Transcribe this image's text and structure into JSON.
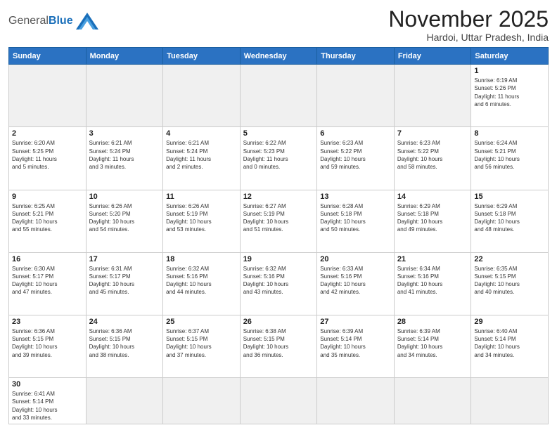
{
  "logo": {
    "text_general": "General",
    "text_blue": "Blue"
  },
  "title": "November 2025",
  "subtitle": "Hardoi, Uttar Pradesh, India",
  "weekdays": [
    "Sunday",
    "Monday",
    "Tuesday",
    "Wednesday",
    "Thursday",
    "Friday",
    "Saturday"
  ],
  "weeks": [
    [
      {
        "day": "",
        "info": ""
      },
      {
        "day": "",
        "info": ""
      },
      {
        "day": "",
        "info": ""
      },
      {
        "day": "",
        "info": ""
      },
      {
        "day": "",
        "info": ""
      },
      {
        "day": "",
        "info": ""
      },
      {
        "day": "1",
        "info": "Sunrise: 6:19 AM\nSunset: 5:26 PM\nDaylight: 11 hours\nand 6 minutes."
      }
    ],
    [
      {
        "day": "2",
        "info": "Sunrise: 6:20 AM\nSunset: 5:25 PM\nDaylight: 11 hours\nand 5 minutes."
      },
      {
        "day": "3",
        "info": "Sunrise: 6:21 AM\nSunset: 5:24 PM\nDaylight: 11 hours\nand 3 minutes."
      },
      {
        "day": "4",
        "info": "Sunrise: 6:21 AM\nSunset: 5:24 PM\nDaylight: 11 hours\nand 2 minutes."
      },
      {
        "day": "5",
        "info": "Sunrise: 6:22 AM\nSunset: 5:23 PM\nDaylight: 11 hours\nand 0 minutes."
      },
      {
        "day": "6",
        "info": "Sunrise: 6:23 AM\nSunset: 5:22 PM\nDaylight: 10 hours\nand 59 minutes."
      },
      {
        "day": "7",
        "info": "Sunrise: 6:23 AM\nSunset: 5:22 PM\nDaylight: 10 hours\nand 58 minutes."
      },
      {
        "day": "8",
        "info": "Sunrise: 6:24 AM\nSunset: 5:21 PM\nDaylight: 10 hours\nand 56 minutes."
      }
    ],
    [
      {
        "day": "9",
        "info": "Sunrise: 6:25 AM\nSunset: 5:21 PM\nDaylight: 10 hours\nand 55 minutes."
      },
      {
        "day": "10",
        "info": "Sunrise: 6:26 AM\nSunset: 5:20 PM\nDaylight: 10 hours\nand 54 minutes."
      },
      {
        "day": "11",
        "info": "Sunrise: 6:26 AM\nSunset: 5:19 PM\nDaylight: 10 hours\nand 53 minutes."
      },
      {
        "day": "12",
        "info": "Sunrise: 6:27 AM\nSunset: 5:19 PM\nDaylight: 10 hours\nand 51 minutes."
      },
      {
        "day": "13",
        "info": "Sunrise: 6:28 AM\nSunset: 5:18 PM\nDaylight: 10 hours\nand 50 minutes."
      },
      {
        "day": "14",
        "info": "Sunrise: 6:29 AM\nSunset: 5:18 PM\nDaylight: 10 hours\nand 49 minutes."
      },
      {
        "day": "15",
        "info": "Sunrise: 6:29 AM\nSunset: 5:18 PM\nDaylight: 10 hours\nand 48 minutes."
      }
    ],
    [
      {
        "day": "16",
        "info": "Sunrise: 6:30 AM\nSunset: 5:17 PM\nDaylight: 10 hours\nand 47 minutes."
      },
      {
        "day": "17",
        "info": "Sunrise: 6:31 AM\nSunset: 5:17 PM\nDaylight: 10 hours\nand 45 minutes."
      },
      {
        "day": "18",
        "info": "Sunrise: 6:32 AM\nSunset: 5:16 PM\nDaylight: 10 hours\nand 44 minutes."
      },
      {
        "day": "19",
        "info": "Sunrise: 6:32 AM\nSunset: 5:16 PM\nDaylight: 10 hours\nand 43 minutes."
      },
      {
        "day": "20",
        "info": "Sunrise: 6:33 AM\nSunset: 5:16 PM\nDaylight: 10 hours\nand 42 minutes."
      },
      {
        "day": "21",
        "info": "Sunrise: 6:34 AM\nSunset: 5:16 PM\nDaylight: 10 hours\nand 41 minutes."
      },
      {
        "day": "22",
        "info": "Sunrise: 6:35 AM\nSunset: 5:15 PM\nDaylight: 10 hours\nand 40 minutes."
      }
    ],
    [
      {
        "day": "23",
        "info": "Sunrise: 6:36 AM\nSunset: 5:15 PM\nDaylight: 10 hours\nand 39 minutes."
      },
      {
        "day": "24",
        "info": "Sunrise: 6:36 AM\nSunset: 5:15 PM\nDaylight: 10 hours\nand 38 minutes."
      },
      {
        "day": "25",
        "info": "Sunrise: 6:37 AM\nSunset: 5:15 PM\nDaylight: 10 hours\nand 37 minutes."
      },
      {
        "day": "26",
        "info": "Sunrise: 6:38 AM\nSunset: 5:15 PM\nDaylight: 10 hours\nand 36 minutes."
      },
      {
        "day": "27",
        "info": "Sunrise: 6:39 AM\nSunset: 5:14 PM\nDaylight: 10 hours\nand 35 minutes."
      },
      {
        "day": "28",
        "info": "Sunrise: 6:39 AM\nSunset: 5:14 PM\nDaylight: 10 hours\nand 34 minutes."
      },
      {
        "day": "29",
        "info": "Sunrise: 6:40 AM\nSunset: 5:14 PM\nDaylight: 10 hours\nand 34 minutes."
      }
    ],
    [
      {
        "day": "30",
        "info": "Sunrise: 6:41 AM\nSunset: 5:14 PM\nDaylight: 10 hours\nand 33 minutes."
      },
      {
        "day": "",
        "info": ""
      },
      {
        "day": "",
        "info": ""
      },
      {
        "day": "",
        "info": ""
      },
      {
        "day": "",
        "info": ""
      },
      {
        "day": "",
        "info": ""
      },
      {
        "day": "",
        "info": ""
      }
    ]
  ]
}
